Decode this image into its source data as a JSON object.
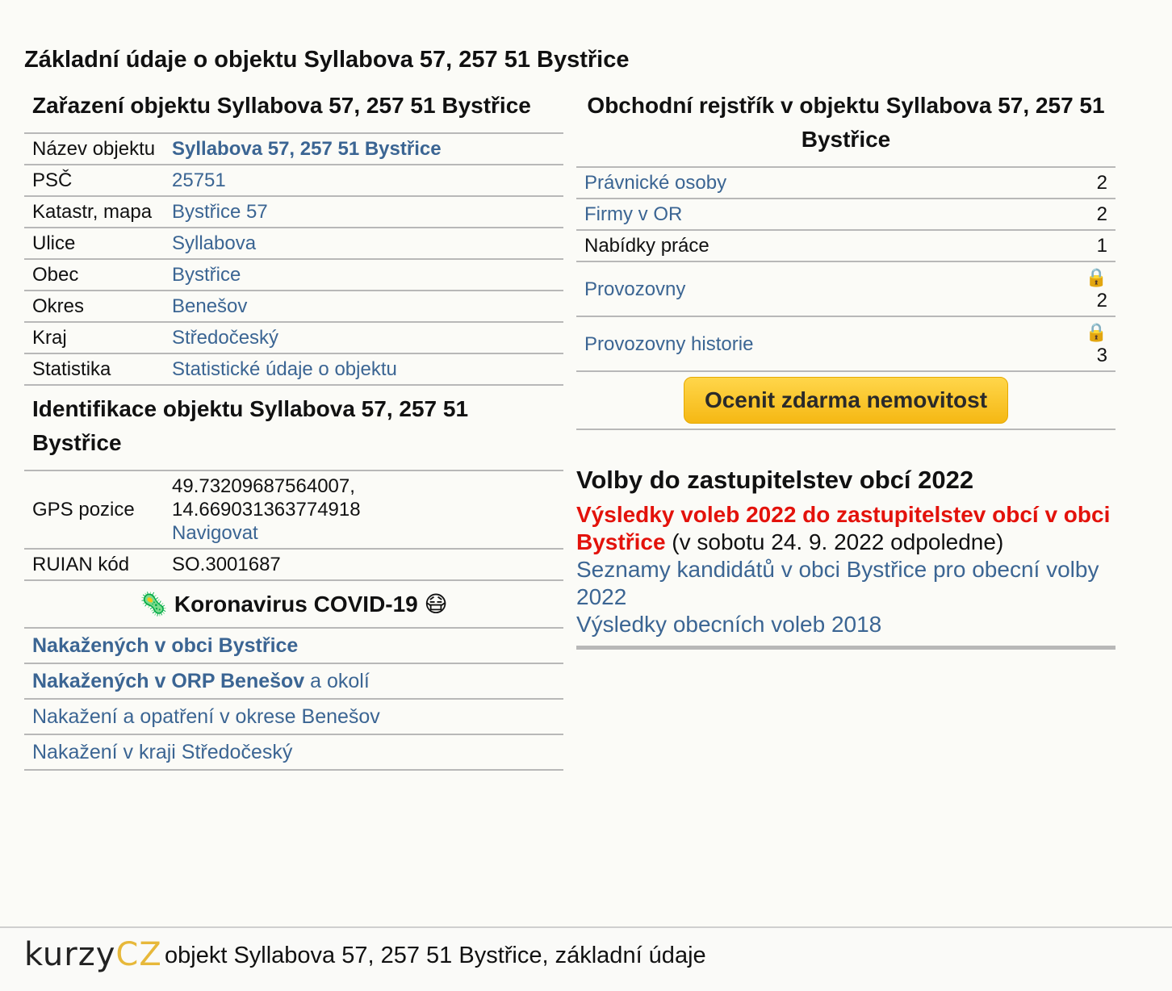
{
  "page_title": "Základní údaje o objektu Syllabova 57, 257 51 Bystřice",
  "zarazeni": {
    "heading": "Zařazení objektu Syllabova 57, 257 51 Bystřice",
    "rows": [
      {
        "label": "Název objektu",
        "value": "Syllabova 57, 257 51 Bystřice"
      },
      {
        "label": "PSČ",
        "value": "25751"
      },
      {
        "label": "Katastr, mapa",
        "value": "Bystřice 57"
      },
      {
        "label": "Ulice",
        "value": "Syllabova"
      },
      {
        "label": "Obec",
        "value": "Bystřice"
      },
      {
        "label": "Okres",
        "value": "Benešov"
      },
      {
        "label": "Kraj",
        "value": "Středočeský"
      },
      {
        "label": "Statistika",
        "value": "Statistické údaje o objektu"
      }
    ]
  },
  "identifikace": {
    "heading": "Identifikace objektu Syllabova 57, 257 51 Bystřice",
    "gps_label": "GPS pozice",
    "gps_lat": "49.73209687564007,",
    "gps_lon": "14.669031363774918",
    "navigovat": "Navigovat",
    "ruian_label": "RUIAN kód",
    "ruian_value": "SO.3001687"
  },
  "covid": {
    "heading": "🦠 Koronavirus COVID-19 😷",
    "links": [
      {
        "bold": "Nakažených v obci Bystřice",
        "rest": ""
      },
      {
        "bold": "Nakažených v ORP Benešov",
        "rest": " a okolí"
      },
      {
        "bold": "",
        "rest": "Nakažení a opatření v okrese Benešov"
      },
      {
        "bold": "",
        "rest": "Nakažení v kraji Středočeský"
      }
    ]
  },
  "rejstrik": {
    "heading": "Obchodní rejstřík v objektu Syllabova 57, 257 51 Bystřice",
    "rows": [
      {
        "label": "Právnické osoby",
        "count": "2",
        "link": true,
        "locked": false
      },
      {
        "label": "Firmy v OR",
        "count": "2",
        "link": true,
        "locked": false
      },
      {
        "label": "Nabídky práce",
        "count": "1",
        "link": false,
        "locked": false
      },
      {
        "label": "Provozovny",
        "count": "2",
        "link": true,
        "locked": true
      },
      {
        "label": "Provozovny historie",
        "count": "3",
        "link": true,
        "locked": true
      }
    ],
    "button": "Ocenit zdarma nemovitost"
  },
  "volby": {
    "heading": "Volby do zastupitelstev obcí 2022",
    "result_link": "Výsledky voleb 2022 do zastupitelstev obcí v obci Bystřice",
    "result_note": " (v sobotu 24. 9. 2022 odpoledne)",
    "kandidati": "Seznamy kandidátů v obci Bystřice pro obecní volby 2022",
    "vysledky2018": "Výsledky obecních voleb 2018"
  },
  "footer": {
    "logo_a": "KURZY",
    "logo_b": "CZ",
    "text": "objekt Syllabova 57, 257 51 Bystřice, základní údaje"
  },
  "icons": {
    "lock": "lock-icon",
    "virus": "virus-icon",
    "mask": "mask-face-icon"
  }
}
